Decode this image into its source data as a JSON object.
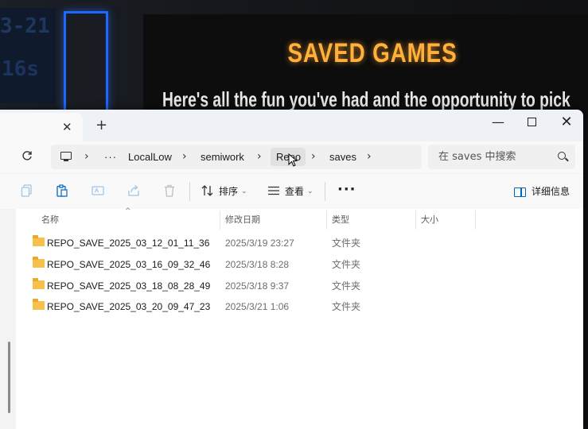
{
  "game": {
    "title": "SAVED GAMES",
    "subtitle": "Here's all the fun you've had and the opportunity to pick",
    "counter_top": "3-21",
    "counter_bottom": "16s"
  },
  "window": {
    "tab_close": "✕",
    "new_tab": "+",
    "minimize": "—",
    "close": "✕"
  },
  "address": {
    "more": "···",
    "crumbs": [
      "LocalLow",
      "semiwork",
      "Repo",
      "saves"
    ],
    "sep": "›",
    "search_placeholder": "在 saves 中搜索"
  },
  "toolbar": {
    "sort_label": "排序",
    "view_label": "查看",
    "more": "···",
    "details_label": "详细信息",
    "chevron": "⌄"
  },
  "columns": {
    "name": "名称",
    "date": "修改日期",
    "type": "类型",
    "size": "大小"
  },
  "files": [
    {
      "name": "REPO_SAVE_2025_03_12_01_11_36",
      "date": "2025/3/19 23:27",
      "type": "文件夹",
      "size": ""
    },
    {
      "name": "REPO_SAVE_2025_03_16_09_32_46",
      "date": "2025/3/18 8:28",
      "type": "文件夹",
      "size": ""
    },
    {
      "name": "REPO_SAVE_2025_03_18_08_28_49",
      "date": "2025/3/18 9:37",
      "type": "文件夹",
      "size": ""
    },
    {
      "name": "REPO_SAVE_2025_03_20_09_47_23",
      "date": "2025/3/21 1:06",
      "type": "文件夹",
      "size": ""
    }
  ],
  "colors": {
    "game_title": "#ffb13b",
    "game_frame": "#1d68ff",
    "folder": "#f7c04a",
    "accent": "#0067c0"
  }
}
